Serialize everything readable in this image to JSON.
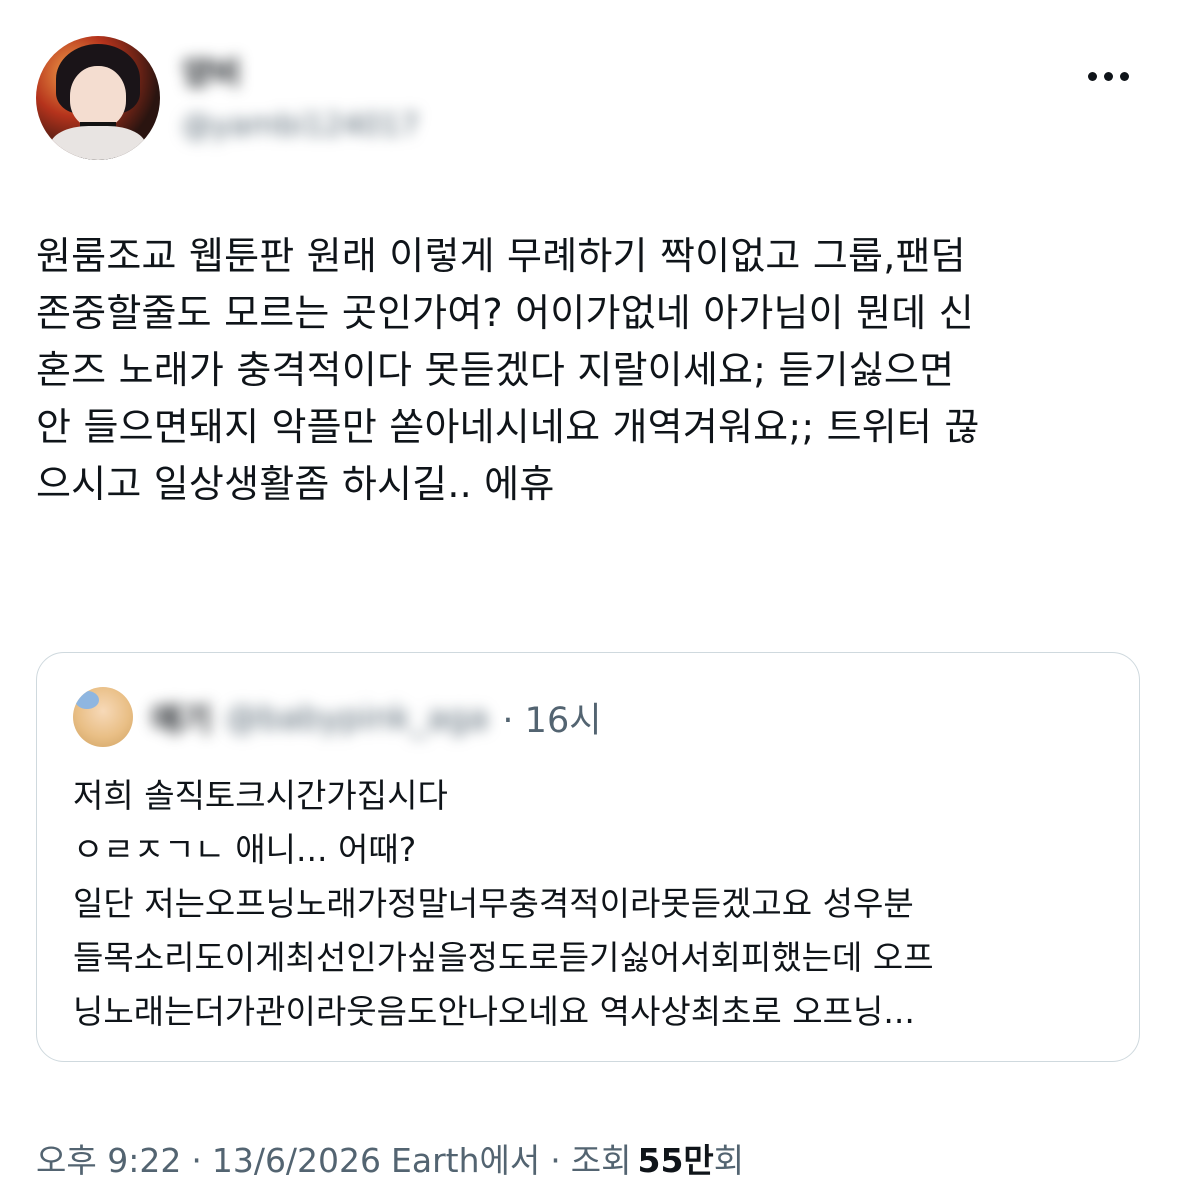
{
  "author": {
    "display_name": "양비",
    "handle": "@yambi124017"
  },
  "tweet": {
    "text": "원룸조교 웹툰판 원래 이렇게 무례하기 짝이없고 그룹,팬덤\n존중할줄도 모르는 곳인가여? 어이가없네 아가님이 뭔데 신\n혼즈 노래가 충격적이다 못듣겠다 지랄이세요; 듣기싫으면\n안 들으면돼지 악플만 쏟아네시네요 개역겨워요;; 트위터 끊\n으시고 일상생활좀 하시길.. 에휴"
  },
  "quoted": {
    "display_name": "애기",
    "handle": "@babypink_aga",
    "time": "· 16시",
    "text": "저희 솔직토크시간가집시다\nㅇㄹㅈㄱㄴ 애니... 어때?\n일단 저는오프닝노래가정말너무충격적이라못듣겠고요 성우분\n들목소리도이게최선인가싶을정도로듣기싫어서회피했는데 오프\n닝노래는더가관이라웃음도안나오네요 역사상최초로 오프닝..."
  },
  "meta": {
    "time": "오후 9:22",
    "sep1": "·",
    "date": "13/6/2026",
    "source": "Earth에서",
    "sep2": "·",
    "views_label": "조회",
    "views_count": "55만",
    "views_suffix": "회"
  },
  "icons": {
    "more": "more-horizontal-icon"
  }
}
